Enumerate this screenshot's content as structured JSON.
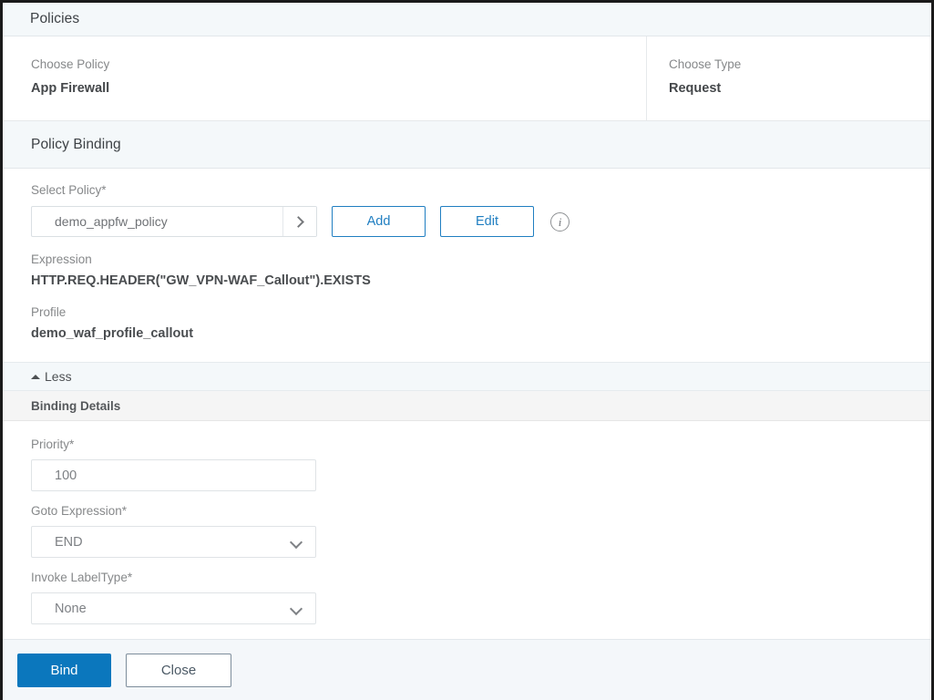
{
  "policies": {
    "section_title": "Policies",
    "choose_policy": {
      "label": "Choose Policy",
      "value": "App Firewall"
    },
    "choose_type": {
      "label": "Choose Type",
      "value": "Request"
    }
  },
  "policy_binding": {
    "section_title": "Policy Binding",
    "select_policy": {
      "label": "Select Policy*",
      "value": "demo_appfw_policy",
      "expand_icon": "chevron-right-icon"
    },
    "add_label": "Add",
    "edit_label": "Edit",
    "info_icon": "info-icon",
    "expression": {
      "label": "Expression",
      "value": "HTTP.REQ.HEADER(\"GW_VPN-WAF_Callout\").EXISTS"
    },
    "profile": {
      "label": "Profile",
      "value": "demo_waf_profile_callout"
    },
    "toggle": {
      "label": "Less",
      "icon": "triangle-up-icon"
    }
  },
  "binding_details": {
    "section_title": "Binding Details",
    "priority": {
      "label": "Priority*",
      "value": "100",
      "placeholder": "100"
    },
    "goto_expression": {
      "label": "Goto Expression*",
      "value": "END",
      "chevron": "chevron-down-icon"
    },
    "invoke_labeltype": {
      "label": "Invoke LabelType*",
      "value": "None",
      "chevron": "chevron-down-icon"
    }
  },
  "footer": {
    "bind_label": "Bind",
    "close_label": "Close"
  },
  "colors": {
    "accent_blue": "#0b77bd",
    "link_blue": "#1f7ec1",
    "header_band": "#f4f8fa",
    "subbar_grey": "#f5f5f5",
    "footer_bg": "#f4f7fa",
    "text_muted": "#86888a",
    "text_strong": "#44474a"
  }
}
